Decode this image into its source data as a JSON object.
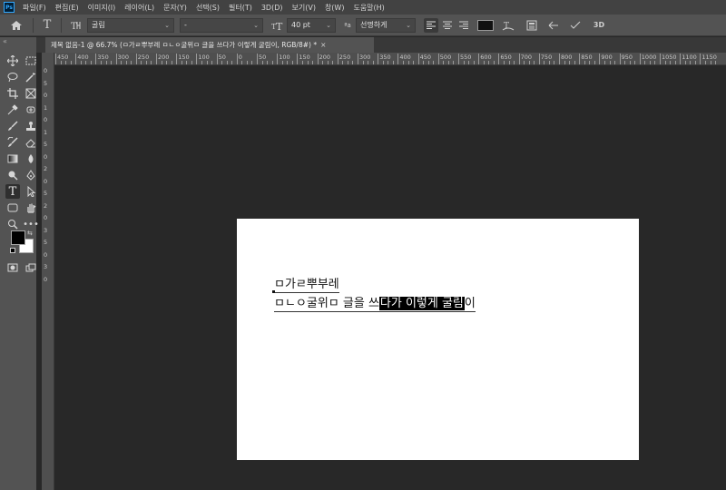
{
  "menubar": {
    "logo": "Ps",
    "items": [
      "파일(F)",
      "편집(E)",
      "이미지(I)",
      "레이어(L)",
      "문자(Y)",
      "선택(S)",
      "필터(T)",
      "3D(D)",
      "보기(V)",
      "창(W)",
      "도움말(H)"
    ]
  },
  "options": {
    "font_family": "굴림",
    "font_style": "-",
    "font_size": "40 pt",
    "anti_alias": "선명하게",
    "text_color": "#111111"
  },
  "document_tab": {
    "title": "제목 없음-1 @ 66.7% (ㅁ가ㄹ뿌부레 ㅁㄴㅇ굴위ㅁ 글을 쓰다가 이렇게 굴림이, RGB/8#) *",
    "close": "×"
  },
  "ruler_top_labels": [
    "450",
    "400",
    "350",
    "300",
    "250",
    "200",
    "150",
    "100",
    "50",
    "0",
    "50",
    "100",
    "150",
    "200",
    "250",
    "300",
    "350",
    "400",
    "450",
    "500",
    "550",
    "600",
    "650",
    "700",
    "750",
    "800",
    "850",
    "900",
    "950",
    "1000",
    "1050",
    "1100",
    "1150"
  ],
  "ruler_left_labels": [
    "0",
    "5",
    "0",
    "1",
    "0",
    "1",
    "5",
    "0",
    "2",
    "0",
    "5",
    "2",
    "0",
    "3",
    "5",
    "0",
    "3",
    "0"
  ],
  "canvas_text": {
    "line1": "ㅁ가ㄹ뿌부레",
    "line2_normal": "ㅁㄴㅇ굴위ㅁ 글을 쓰",
    "line2_selected": "다가 이렇게 굴림",
    "line2_tail": "이"
  },
  "colors": {
    "menubar_bg": "#424242",
    "panel_bg": "#535353",
    "workspace_bg": "#282828",
    "canvas_bg": "#ffffff",
    "selection_bg": "#000000"
  }
}
